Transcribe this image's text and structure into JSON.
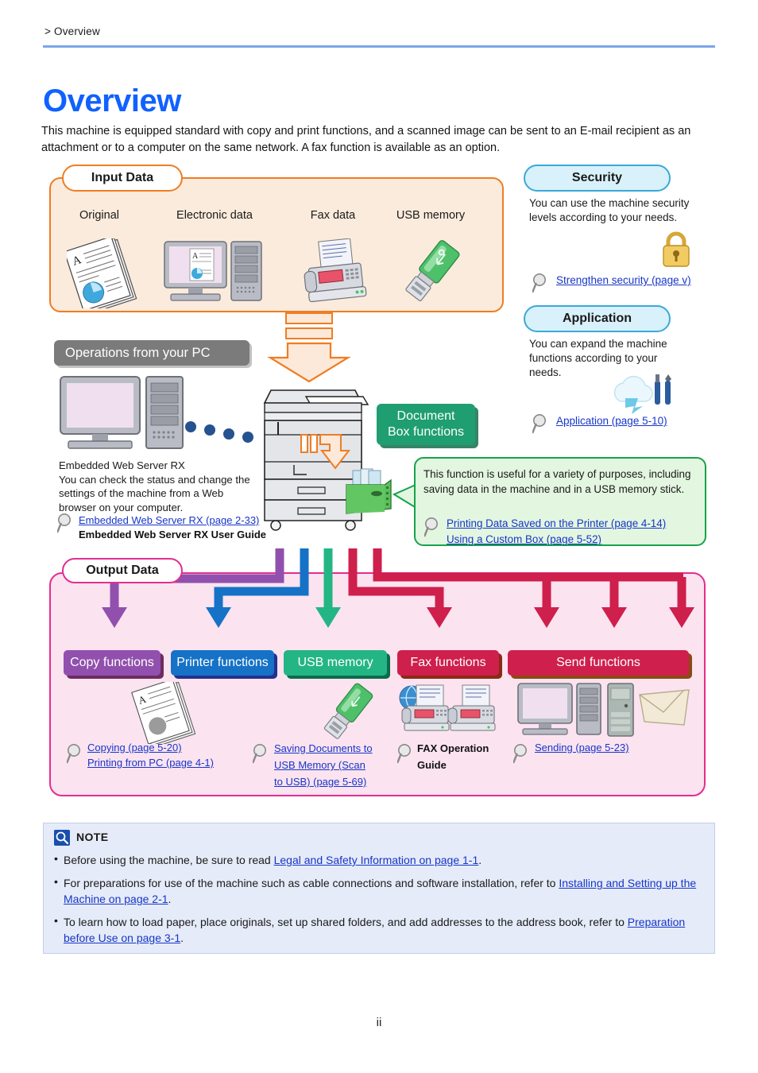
{
  "breadcrumb": "> Overview",
  "page_title": "Overview",
  "intro": "This machine is equipped standard with copy and print functions, and a scanned image can be sent to an E-mail recipient as an attachment or to a computer on the same network. A fax function is available as an option.",
  "colors": {
    "title_blue": "#1061ff",
    "rule_blue": "#7ba7e8",
    "input_orange": "#ef7d22",
    "input_fill": "#fbebdc",
    "cyan_border": "#3aa9d8",
    "cyan_fill": "#d8f1fb",
    "output_magenta": "#e32d91",
    "output_fill": "#fbe3f0",
    "green_border": "#16a34a",
    "green_fill": "#e3f6e0",
    "docbox_green": "#1f9e72",
    "copy_purple": "#9150ad",
    "printer_blue": "#1572c6",
    "usb_green": "#24b585",
    "fax_red": "#cf1f4c",
    "send_red": "#cf1f4c",
    "ops_gray": "#7b7b7b",
    "note_bg": "#e5ebf8",
    "link_blue": "#1736c8"
  },
  "input_section": {
    "tab_label": "Input Data",
    "columns": [
      {
        "label": "Original",
        "icon": "document-stack-icon"
      },
      {
        "label": "Electronic data",
        "icon": "desktop-computer-icon"
      },
      {
        "label": "Fax data",
        "icon": "fax-machine-icon"
      },
      {
        "label": "USB memory",
        "icon": "usb-flash-drive-icon"
      }
    ]
  },
  "security_section": {
    "tab_label": "Security",
    "description": "You can use the machine security levels according to your needs.",
    "icon": "padlock-icon",
    "link": "Strengthen security (page v)"
  },
  "application_section": {
    "tab_label": "Application",
    "description": "You can expand the machine functions according to your needs.",
    "icon": "cloud-tools-icon",
    "link": "Application (page 5-10)"
  },
  "operations_section": {
    "tab_label": "Operations from your PC",
    "icon": "desktop-computer-icon",
    "heading": "Embedded Web Server RX",
    "description": "You can check the status and change the settings of the machine from a Web browser on your computer.",
    "link": "Embedded Web Server RX (page 2-33)",
    "guide": "Embedded Web Server RX User Guide"
  },
  "docbox_section": {
    "tab_line1": "Document",
    "tab_line2": "Box functions",
    "callout_text": "This function is useful for a variety of purposes, including saving data in the machine and in a USB memory stick.",
    "links": [
      "Printing Data Saved on the Printer (page 4-14)",
      "Using a Custom Box (page 5-52)"
    ]
  },
  "machine": {
    "icon": "multifunction-printer-icon",
    "docbox_icon": "green-file-box-icon"
  },
  "output_section": {
    "tab_label": "Output Data",
    "functions": [
      {
        "label": "Copy functions",
        "color": "#9150ad",
        "shadow": "#6d2c60",
        "icon": "document-stack-icon",
        "links": [
          "Copying (page 5-20)",
          "Printing from PC (page 4-1)"
        ],
        "bold_text": ""
      },
      {
        "label": "Printer functions",
        "color": "#1572c6",
        "shadow": "#243090",
        "icon": "",
        "links": [],
        "bold_text": ""
      },
      {
        "label": "USB memory",
        "color": "#24b585",
        "shadow": "#0d6b4d",
        "icon": "usb-flash-drive-icon",
        "links": [
          "Saving Documents to",
          "USB Memory (Scan",
          "to USB) (page 5-69)"
        ],
        "bold_text": ""
      },
      {
        "label": "Fax functions",
        "color": "#cf1f4c",
        "shadow": "#8b2a14",
        "icon": "fax-machines-icon",
        "links": [],
        "bold_text": "FAX Operation Guide"
      },
      {
        "label": "Send functions",
        "color": "#cf1f4c",
        "shadow": "#8b4a14",
        "icon": "pc-server-mail-icon",
        "links": [
          "Sending (page 5-23)"
        ],
        "bold_text": ""
      }
    ]
  },
  "note_section": {
    "title": "NOTE",
    "icon": "note-magnifier-icon",
    "items": [
      {
        "prefix": "Before using the machine, be sure to read ",
        "link": "Legal and Safety Information on page 1-1",
        "suffix": "."
      },
      {
        "prefix": "For preparations for use of the machine such as cable connections and software installation, refer to ",
        "link": "Installing and Setting up the Machine on page 2-1",
        "suffix": "."
      },
      {
        "prefix": "To learn how to load paper, place originals, set up shared folders, and add addresses to the address book, refer to ",
        "link": "Preparation before Use on page 3-1",
        "suffix": "."
      }
    ],
    "bullet": "•"
  },
  "footer": {
    "page_number": "ii"
  }
}
